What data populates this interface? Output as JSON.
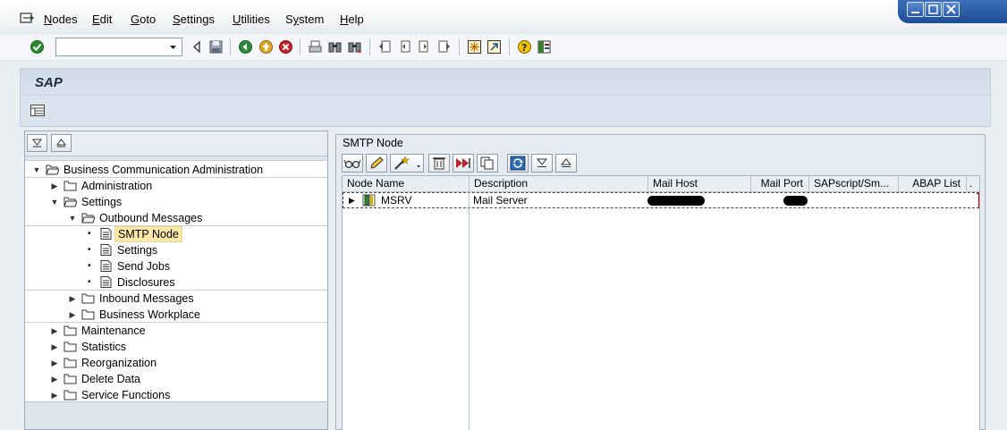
{
  "menubar": {
    "items": [
      {
        "label": "Nodes",
        "underline": "N"
      },
      {
        "label": "Edit",
        "underline": "E"
      },
      {
        "label": "Goto",
        "underline": "G"
      },
      {
        "label": "Settings",
        "underline": "S"
      },
      {
        "label": "Utilities",
        "underline": "U"
      },
      {
        "label": "System",
        "underline": "y"
      },
      {
        "label": "Help",
        "underline": "H"
      }
    ]
  },
  "toolbar": {
    "command_field_value": ""
  },
  "app": {
    "title": "SAP"
  },
  "tree": {
    "root": "Business Communication Administration",
    "items": [
      {
        "label": "Administration"
      },
      {
        "label": "Settings"
      },
      {
        "label": "Outbound Messages"
      },
      {
        "label": "SMTP Node"
      },
      {
        "label": "Settings"
      },
      {
        "label": "Send Jobs"
      },
      {
        "label": "Disclosures"
      },
      {
        "label": "Inbound Messages"
      },
      {
        "label": "Business Workplace"
      },
      {
        "label": "Maintenance"
      },
      {
        "label": "Statistics"
      },
      {
        "label": "Reorganization"
      },
      {
        "label": "Delete Data"
      },
      {
        "label": "Service Functions"
      }
    ],
    "selected": "SMTP Node"
  },
  "panel": {
    "title": "SMTP Node"
  },
  "grid": {
    "columns": [
      "Node Name",
      "Description",
      "Mail Host",
      "Mail Port",
      "SAPscript/Sm...",
      "ABAP List",
      "."
    ],
    "rows": [
      {
        "node_name": "MSRV",
        "description": "Mail Server",
        "mail_host": "",
        "mail_port": "",
        "sapscript": "",
        "abap_list": ""
      }
    ]
  },
  "colors": {
    "accent": "#1c4d96",
    "selection": "#fbe8a6",
    "panel_bg": "#dae4ee"
  }
}
